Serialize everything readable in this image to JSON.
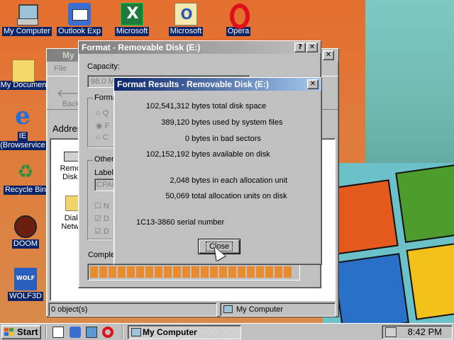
{
  "desktop": {
    "icons": [
      {
        "label": "My Computer",
        "icon": "computer-icon"
      },
      {
        "label": "Outlook Exp",
        "icon": "outlook-express-icon"
      },
      {
        "label": "Microsoft",
        "icon": "excel-icon"
      },
      {
        "label": "Microsoft",
        "icon": "outlook-icon"
      },
      {
        "label": "Opera",
        "icon": "opera-icon"
      },
      {
        "label": "My Documen",
        "icon": "documents-icon"
      },
      {
        "label": "IE",
        "label2": "(Browservice",
        "icon": "ie-icon"
      },
      {
        "label": "Recycle Bin",
        "icon": "recycle-bin-icon"
      },
      {
        "label": "DOOM",
        "icon": "doom-icon"
      },
      {
        "label": "WOLF3D",
        "icon": "wolf3d-icon"
      }
    ]
  },
  "explorer": {
    "title": "My",
    "menu_file": "File",
    "back_label": "Back",
    "address_label": "Address",
    "items": [
      {
        "label1": "Remov",
        "label2": "Disk (",
        "icon": "removable-disk-icon"
      },
      {
        "label1": "Dial-",
        "label2": "Netwo",
        "icon": "dial-up-networking-icon"
      }
    ],
    "status_left": "0 object(s)",
    "status_right": "My Computer"
  },
  "format_dialog": {
    "title": "Format - Removable Disk (E:)",
    "capacity_label": "Capacity:",
    "capacity_value": "98.0 M",
    "format_type_label": "Forma",
    "options": [
      "Q",
      "F",
      "C"
    ],
    "other_label": "Other",
    "disk_label": "Label",
    "disk_label_value": "CPAR",
    "checkboxes": [
      "N",
      "D",
      "D"
    ],
    "complete_label": "Complet",
    "progress_percent": 100
  },
  "results_dialog": {
    "title": "Format Results - Removable Disk (E:)",
    "rows": [
      {
        "num": "102,541,312",
        "text": "bytes total disk space"
      },
      {
        "num": "389,120",
        "text": "bytes used by system files"
      },
      {
        "num": "0",
        "text": "bytes in bad sectors"
      },
      {
        "num": "102,152,192",
        "text": "bytes available on disk"
      },
      {
        "num": "2,048",
        "text": "bytes in each allocation unit"
      },
      {
        "num": "50,069",
        "text": "total allocation units on disk"
      }
    ],
    "serial": "1C13-3860",
    "serial_text": "serial number",
    "close_label": "Close"
  },
  "taskbar": {
    "start_label": "Start",
    "task_label": "My Computer",
    "clock": "8:42 PM"
  },
  "colors": {
    "desktop": "#e07a3a",
    "title_active": "#0a246a",
    "progress": "#e98a2d"
  }
}
